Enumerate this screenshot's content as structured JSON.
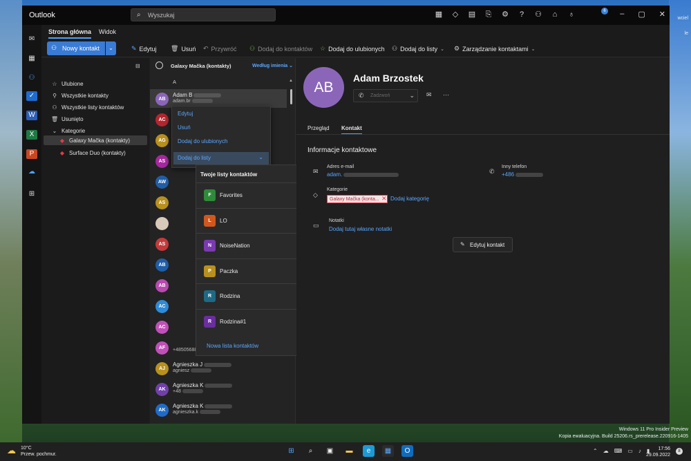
{
  "app": {
    "title": "Outlook"
  },
  "search": {
    "placeholder": "Wyszukaj",
    "icon": "search-icon"
  },
  "notification_badge": "6",
  "ribbon_tabs": [
    "Strona główna",
    "Widok"
  ],
  "ribbon": {
    "new_contact": "Nowy kontakt",
    "edit": "Edytuj",
    "delete": "Usuń",
    "restore": "Przywróć",
    "add_to_contacts": "Dodaj do kontaktów",
    "add_to_favorites": "Dodaj do ulubionych",
    "add_to_list": "Dodaj do listy",
    "manage_contacts": "Zarządzanie kontaktami"
  },
  "folders": {
    "items": [
      "Ulubione",
      "Wszystkie kontakty",
      "Wszystkie listy kontaktów",
      "Usunięto",
      "Kategorie"
    ],
    "categories": [
      "Galaxy Mačka (kontakty)",
      "Surface Duo (kontakty)"
    ]
  },
  "contact_list": {
    "header": "Galaxy Mačka (kontakty)",
    "sort": "Według imienia",
    "section": "A",
    "rows": [
      {
        "initials": "AB",
        "color": "#8b66b8",
        "name": "Adam B",
        "sub": "adam.br"
      },
      {
        "initials": "AC",
        "color": "#b4262e",
        "name": "",
        "sub": ""
      },
      {
        "initials": "AG",
        "color": "#b8901e",
        "name": "",
        "sub": ""
      },
      {
        "initials": "AS",
        "color": "#a4289e",
        "name": "",
        "sub": ""
      },
      {
        "initials": "AW",
        "color": "#1f5ea8",
        "name": "",
        "sub": ""
      },
      {
        "initials": "AS",
        "color": "#b8901e",
        "name": "",
        "sub": ""
      },
      {
        "initials": "",
        "color": "#d9c9b8",
        "name": "",
        "sub": ""
      },
      {
        "initials": "AS",
        "color": "#c43a3a",
        "name": "",
        "sub": ""
      },
      {
        "initials": "AB",
        "color": "#1f5ea8",
        "name": "",
        "sub": ""
      },
      {
        "initials": "AB",
        "color": "#b84ab0",
        "name": "",
        "sub": ""
      },
      {
        "initials": "AC",
        "color": "#2e8bd8",
        "name": "",
        "sub": ""
      },
      {
        "initials": "AC",
        "color": "#c050b8",
        "name": "",
        "sub": ""
      },
      {
        "initials": "AF",
        "color": "#c050b8",
        "name": "",
        "sub": "+4850568820"
      },
      {
        "initials": "AJ",
        "color": "#b8901e",
        "name": "Agnieszka J",
        "sub": "agniesz"
      },
      {
        "initials": "AK",
        "color": "#7040a8",
        "name": "Agnieszka K",
        "sub": "+48"
      },
      {
        "initials": "AK",
        "color": "#1f6cc8",
        "name": "Agnieszka K",
        "sub": "agnieszka.k"
      }
    ]
  },
  "context_menu": {
    "items": [
      "Edytuj",
      "Usuń",
      "Dodaj do ulubionych",
      "Dodaj do listy"
    ]
  },
  "sublist": {
    "title": "Twoje listy kontaktów",
    "lists": [
      {
        "letter": "F",
        "color": "#2f8a3a",
        "name": "Favorites"
      },
      {
        "letter": "L",
        "color": "#d0581e",
        "name": "LO"
      },
      {
        "letter": "N",
        "color": "#7a3ab0",
        "name": "NoiseNation"
      },
      {
        "letter": "P",
        "color": "#b8901e",
        "name": "Paczka"
      },
      {
        "letter": "R",
        "color": "#1e6a84",
        "name": "Rodzina"
      },
      {
        "letter": "R",
        "color": "#6a2e9e",
        "name": "Rodzina#1"
      }
    ],
    "new_list": "Nowa lista kontaktów"
  },
  "detail": {
    "initials": "AB",
    "name": "Adam Brzostek",
    "call_label": "Zadzwoń",
    "tabs": [
      "Przegląd",
      "Kontakt"
    ],
    "section_title": "Informacje kontaktowe",
    "email_label": "Adres e-mail",
    "email_value": "adam.",
    "phone_label": "Inny telefon",
    "phone_value": "+486",
    "category_label": "Kategorie",
    "category_chip": "Galaxy Mačka (konta...",
    "add_category": "Dodaj kategorię",
    "notes_label": "Notatki",
    "notes_link": "Dodaj tutaj własne notatki",
    "edit_contact": "Edytuj kontakt"
  },
  "desktop_watermark": {
    "line1": "Windows 11 Pro Insider Preview",
    "line2": "Kopia ewaluacyjna. Build 25206.rs_prerelease.220916-1405",
    "corner": [
      "wciel",
      "le"
    ]
  },
  "taskbar": {
    "weather_temp": "10°C",
    "weather_desc": "Przew. pochmur.",
    "time": "17:56",
    "date": "29.09.2022",
    "notif_count": "8"
  },
  "colors": {
    "accent": "#3a7bd5",
    "link": "#5aa7ff",
    "category": "#e03c4b"
  }
}
